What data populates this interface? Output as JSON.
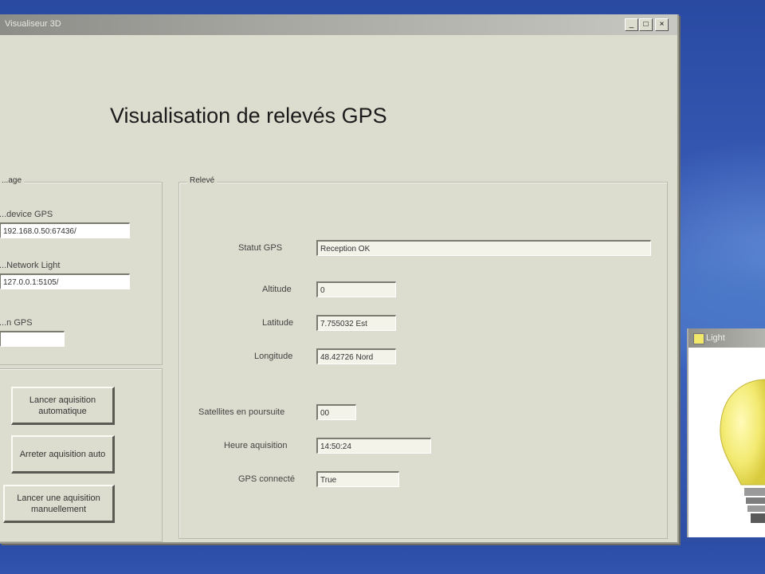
{
  "window": {
    "title": "Visualiseur 3D",
    "controls": {
      "minimize": "_",
      "maximize": "□",
      "close": "×"
    }
  },
  "app_title": "Visualisation de relevés GPS",
  "config": {
    "group_label": "...age",
    "device_label": "...device GPS",
    "device_value": "192.168.0.50:67436/",
    "network_label": "...Network Light",
    "network_value": "127.0.0.1:5105/",
    "gps_label": "...n GPS",
    "gps_value": ""
  },
  "buttons": {
    "auto_start": "Lancer aquisition automatique",
    "auto_stop": "Arreter aquisition auto",
    "manual": "Lancer une aquisition manuellement"
  },
  "releve": {
    "group_label": "Relevé",
    "statut_label": "Statut GPS",
    "statut_value": "Reception OK",
    "altitude_label": "Altitude",
    "altitude_value": "0",
    "latitude_label": "Latitude",
    "latitude_value": "7.755032 Est",
    "longitude_label": "Longitude",
    "longitude_value": "48.42726 Nord",
    "satellites_label": "Satellites en poursuite",
    "satellites_value": "00",
    "heure_label": "Heure aquisition",
    "heure_value": "14:50:24",
    "connecte_label": "GPS connecté",
    "connecte_value": "True"
  },
  "light_window": {
    "title": "Light"
  },
  "colors": {
    "desktop": "#2f4e9a",
    "window_bg": "#dcdccf",
    "bulb": "#f5ee7a"
  }
}
